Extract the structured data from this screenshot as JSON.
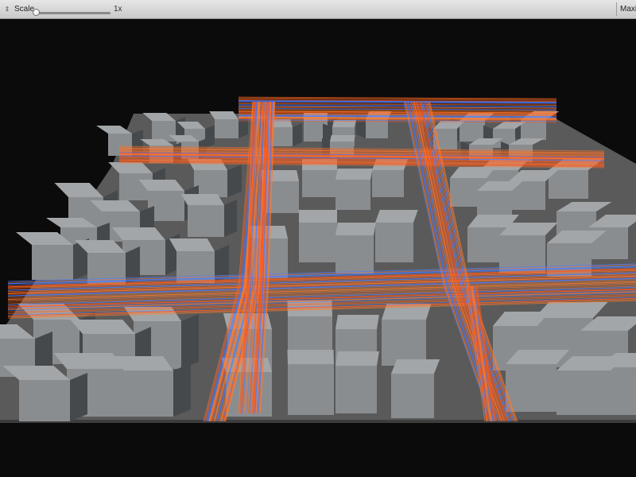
{
  "toolbar": {
    "display_dropdown_icon": "updown-arrow-icon",
    "scale_label": "Scale",
    "scale_value": "1x",
    "scale_level": 0.0,
    "maximize_label": "Maximize on Play"
  },
  "scene": {
    "background": "#0b0b0b",
    "ground_color": "#5a5a5a",
    "building_top": "#a3a6a8",
    "building_front": "#8a8d90",
    "building_side": "#46494c",
    "trail_colors": [
      "#ff7a2a",
      "#ff5a1c",
      "#4a7dff"
    ]
  }
}
